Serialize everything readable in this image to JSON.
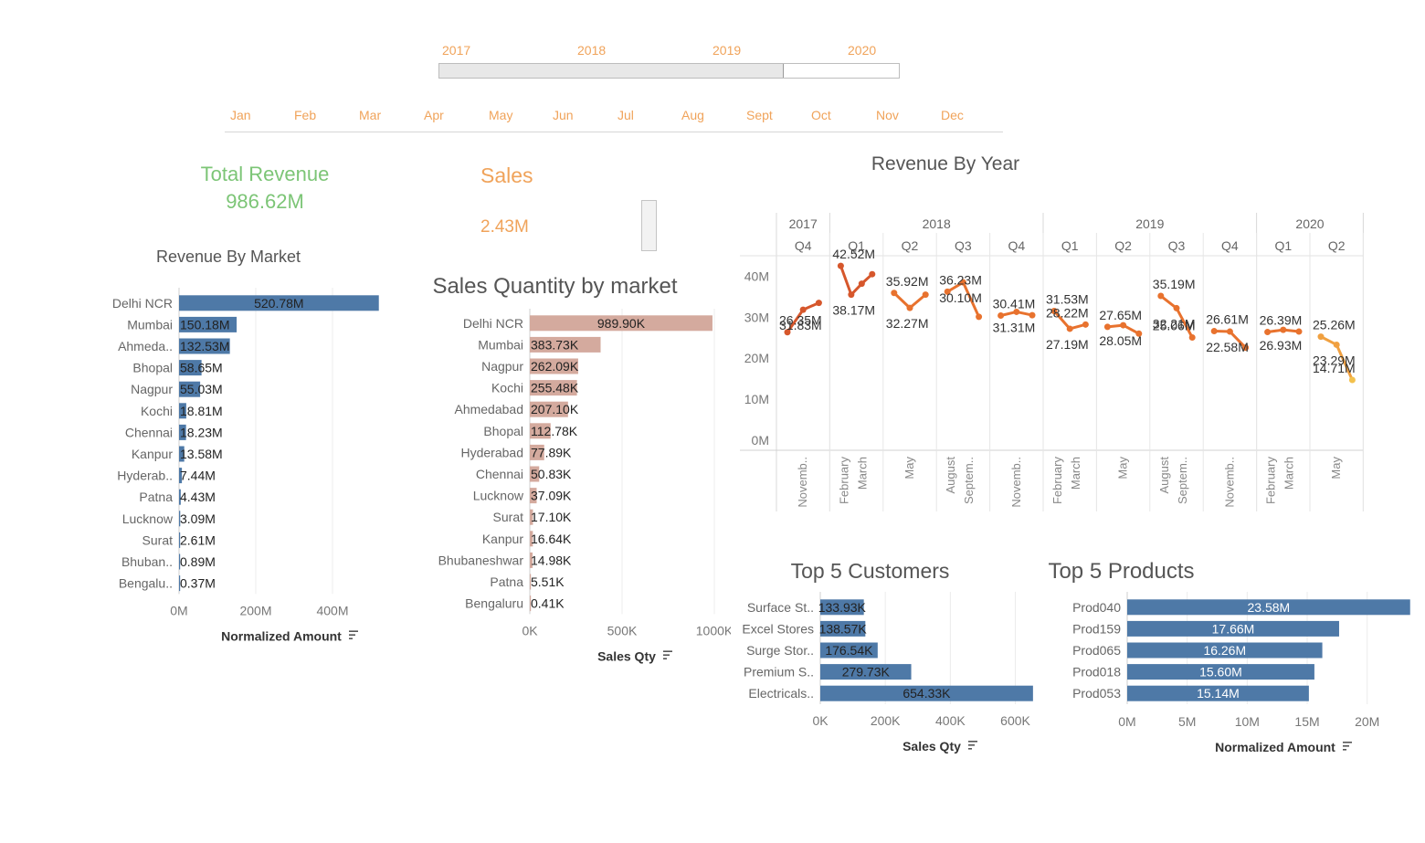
{
  "filters": {
    "years": [
      "2017",
      "2018",
      "2019",
      "2020"
    ],
    "year_range_selected": [
      2017,
      2019
    ],
    "months": [
      "Jan",
      "Feb",
      "Mar",
      "Apr",
      "May",
      "Jun",
      "Jul",
      "Aug",
      "Sept",
      "Oct",
      "Nov",
      "Dec"
    ]
  },
  "kpis": {
    "total_revenue_label": "Total Revenue",
    "total_revenue_value": "986.62M",
    "sales_label": "Sales",
    "sales_value": "2.43M"
  },
  "colors": {
    "orange_text": "#f0a35a",
    "green_text": "#7cc576",
    "blue_bar": "#4e79a7",
    "pink_bar": "#d4a99e",
    "line_dark": "#c9482b",
    "line_light": "#f3c14c"
  },
  "chart_data": [
    {
      "id": "revenue_by_market",
      "type": "bar",
      "orientation": "horizontal",
      "title": "Revenue By Market",
      "xlabel": "Normalized Amount",
      "xlim": [
        0,
        550
      ],
      "xticks": [
        "0M",
        "200M",
        "400M"
      ],
      "categories": [
        "Delhi NCR",
        "Mumbai",
        "Ahmeda..",
        "Bhopal",
        "Nagpur",
        "Kochi",
        "Chennai",
        "Kanpur",
        "Hyderab..",
        "Patna",
        "Lucknow",
        "Surat",
        "Bhuban..",
        "Bengalu.."
      ],
      "values": [
        520.78,
        150.18,
        132.53,
        58.65,
        55.03,
        18.81,
        18.23,
        13.58,
        7.44,
        4.43,
        3.09,
        2.61,
        0.89,
        0.37
      ],
      "labels": [
        "520.78M",
        "150.18M",
        "132.53M",
        "58.65M",
        "55.03M",
        "18.81M",
        "18.23M",
        "13.58M",
        "7.44M",
        "4.43M",
        "3.09M",
        "2.61M",
        "0.89M",
        "0.37M"
      ]
    },
    {
      "id": "sales_qty_by_market",
      "type": "bar",
      "orientation": "horizontal",
      "title": "Sales Quantity by market",
      "xlabel": "Sales Qty",
      "xlim": [
        0,
        1000
      ],
      "xticks": [
        "0K",
        "500K",
        "1000K"
      ],
      "categories": [
        "Delhi NCR",
        "Mumbai",
        "Nagpur",
        "Kochi",
        "Ahmedabad",
        "Bhopal",
        "Hyderabad",
        "Chennai",
        "Lucknow",
        "Surat",
        "Kanpur",
        "Bhubaneshwar",
        "Patna",
        "Bengaluru"
      ],
      "values": [
        989.9,
        383.73,
        262.09,
        255.48,
        207.1,
        112.78,
        77.89,
        50.83,
        37.09,
        17.1,
        16.64,
        14.98,
        5.51,
        0.41
      ],
      "labels": [
        "989.90K",
        "383.73K",
        "262.09K",
        "255.48K",
        "207.10K",
        "112.78K",
        "77.89K",
        "50.83K",
        "37.09K",
        "17.10K",
        "16.64K",
        "14.98K",
        "5.51K",
        "0.41K"
      ]
    },
    {
      "id": "revenue_by_year",
      "type": "line",
      "title": "Revenue By Year",
      "ylim": [
        0,
        45
      ],
      "yticks": [
        "0M",
        "10M",
        "20M",
        "30M",
        "40M"
      ],
      "years": [
        {
          "label": "2017",
          "quarters": 1
        },
        {
          "label": "2018",
          "quarters": 4
        },
        {
          "label": "2019",
          "quarters": 4
        },
        {
          "label": "2020",
          "quarters": 2
        }
      ],
      "quarters": [
        {
          "label": "Q4",
          "months": [
            "Novemb.."
          ],
          "values": [
            26.35,
            31.83,
            33.5
          ],
          "value_labels": [
            "26.35M",
            "31.83M"
          ]
        },
        {
          "label": "Q1",
          "months": [
            "February",
            "March"
          ],
          "values": [
            42.52,
            35.5,
            38.17,
            40.5
          ],
          "value_labels": [
            "42.52M",
            "38.17M"
          ]
        },
        {
          "label": "Q2",
          "months": [
            "May"
          ],
          "values": [
            35.92,
            32.27,
            35.5
          ],
          "value_labels": [
            "35.92M",
            "32.27M"
          ]
        },
        {
          "label": "Q3",
          "months": [
            "August",
            "Septem.."
          ],
          "values": [
            36.23,
            38.5,
            30.1
          ],
          "value_labels": [
            "36.23M",
            "30.10M"
          ]
        },
        {
          "label": "Q4",
          "months": [
            "Novemb.."
          ],
          "values": [
            30.41,
            31.31,
            30.5
          ],
          "value_labels": [
            "30.41M",
            "31.31M"
          ]
        },
        {
          "label": "Q1",
          "months": [
            "February",
            "March"
          ],
          "values": [
            31.53,
            27.19,
            28.22
          ],
          "value_labels": [
            "31.53M",
            "27.19M",
            "28.22M"
          ]
        },
        {
          "label": "Q2",
          "months": [
            "May"
          ],
          "values": [
            27.65,
            28.05,
            26.0
          ],
          "value_labels": [
            "27.65M",
            "28.05M"
          ]
        },
        {
          "label": "Q3",
          "months": [
            "August",
            "Septem.."
          ],
          "values": [
            35.19,
            32.21,
            25.06
          ],
          "value_labels": [
            "35.19M",
            "32.21M",
            "25.06M"
          ]
        },
        {
          "label": "Q4",
          "months": [
            "Novemb.."
          ],
          "values": [
            26.61,
            26.5,
            22.58
          ],
          "value_labels": [
            "26.61M",
            "22.58M"
          ]
        },
        {
          "label": "Q1",
          "months": [
            "February",
            "March"
          ],
          "values": [
            26.39,
            26.93,
            26.5
          ],
          "value_labels": [
            "26.39M",
            "26.93M"
          ]
        },
        {
          "label": "Q2",
          "months": [
            "May"
          ],
          "values": [
            25.26,
            23.29,
            14.71
          ],
          "value_labels": [
            "25.26M",
            "23.29M",
            "14.71M"
          ]
        }
      ]
    },
    {
      "id": "top5_customers",
      "type": "bar",
      "orientation": "horizontal",
      "title": "Top 5 Customers",
      "xlabel": "Sales Qty",
      "xlim": [
        0,
        680
      ],
      "xticks": [
        "0K",
        "200K",
        "400K",
        "600K"
      ],
      "categories": [
        "Surface St..",
        "Excel Stores",
        "Surge Stor..",
        "Premium S..",
        "Electricals.."
      ],
      "values": [
        133.93,
        138.57,
        176.54,
        279.73,
        654.33
      ],
      "labels": [
        "133.93K",
        "138.57K",
        "176.54K",
        "279.73K",
        "654.33K"
      ]
    },
    {
      "id": "top5_products",
      "type": "bar",
      "orientation": "horizontal",
      "title": "Top 5 Products",
      "xlabel": "Normalized Amount",
      "xlim": [
        0,
        23.6
      ],
      "xticks": [
        "0M",
        "5M",
        "10M",
        "15M",
        "20M"
      ],
      "categories": [
        "Prod040",
        "Prod159",
        "Prod065",
        "Prod018",
        "Prod053"
      ],
      "values": [
        23.58,
        17.66,
        16.26,
        15.6,
        15.14
      ],
      "labels": [
        "23.58M",
        "17.66M",
        "16.26M",
        "15.60M",
        "15.14M"
      ]
    }
  ]
}
